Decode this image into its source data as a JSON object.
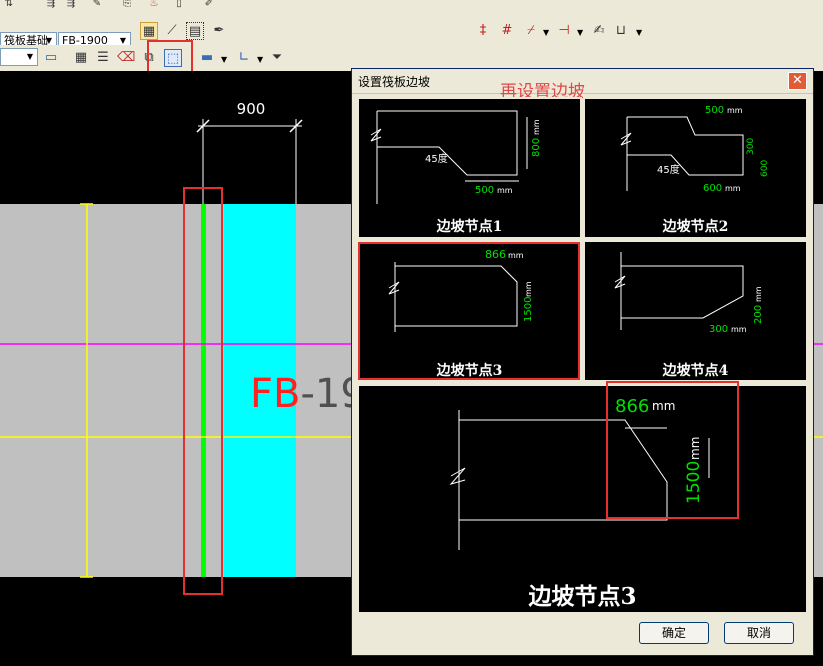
{
  "toolbar": {
    "component_type": "筏板基础",
    "component_name": "FB-1900"
  },
  "drawing": {
    "dimension": "900",
    "label_prefix": "FB",
    "label_suffix": "-19"
  },
  "dialog": {
    "title": "设置筏板边坡",
    "annotation": "再设置边坡",
    "close_glyph": "✕",
    "nodes": [
      {
        "label": "边坡节点1",
        "angle": "45度",
        "dim_h": "500",
        "dim_v": "800",
        "unit": "mm"
      },
      {
        "label": "边坡节点2",
        "angle": "45度",
        "dim_top": "500",
        "dim_v1": "300",
        "dim_v2": "600",
        "dim_bottom": "600",
        "unit": "mm"
      },
      {
        "label": "边坡节点3",
        "dim_h": "866",
        "dim_v": "1500",
        "unit": "mm"
      },
      {
        "label": "边坡节点4",
        "dim_h": "300",
        "dim_v": "200",
        "unit": "mm"
      }
    ],
    "preview": {
      "label": "边坡节点3",
      "dim_h": "866",
      "dim_v": "1500",
      "unit": "mm"
    },
    "ok_label": "确定",
    "cancel_label": "取消"
  },
  "colors": {
    "canvas": "#000000",
    "slab": "#c0c0c0",
    "cyan": "#00ffff",
    "green": "#00ff00",
    "yellow": "#ffff00",
    "magenta": "#ff00ff",
    "highlight": "#e53030",
    "label_red": "#ff2020",
    "dim_green": "#00e000"
  }
}
